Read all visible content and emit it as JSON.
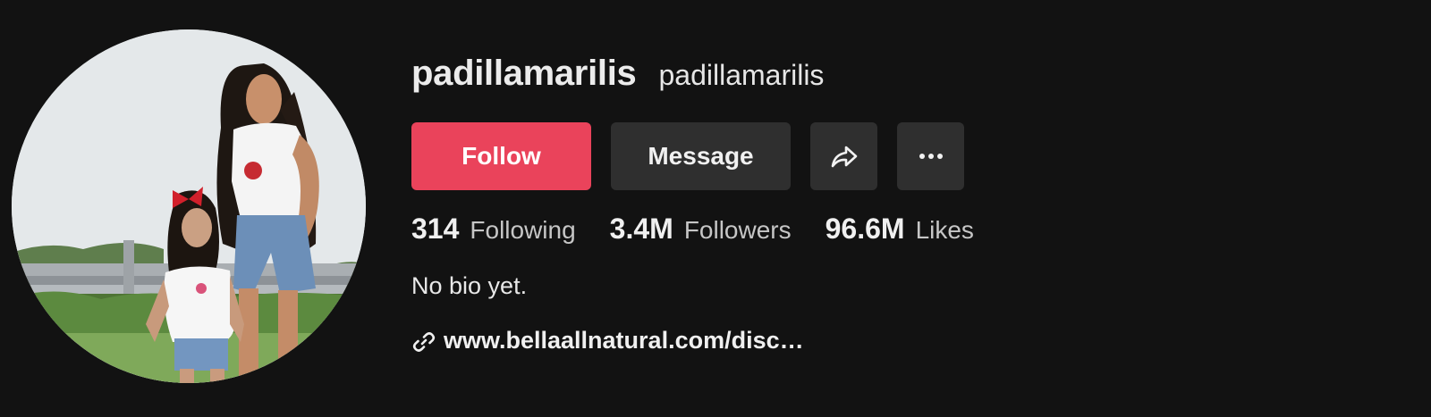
{
  "profile": {
    "display_name": "padillamarilis",
    "handle": "padillamarilis",
    "bio": "No bio yet.",
    "link": "www.bellaallnatural.com/disc…"
  },
  "actions": {
    "follow_label": "Follow",
    "message_label": "Message",
    "share_icon": "share-arrow-icon",
    "more_icon": "more-dots-icon"
  },
  "stats": [
    {
      "value": "314",
      "label": "Following"
    },
    {
      "value": "3.4M",
      "label": "Followers"
    },
    {
      "value": "96.6M",
      "label": "Likes"
    }
  ],
  "colors": {
    "background": "#121212",
    "follow_button": "#ea435b",
    "secondary_button": "#2f2f2f"
  }
}
